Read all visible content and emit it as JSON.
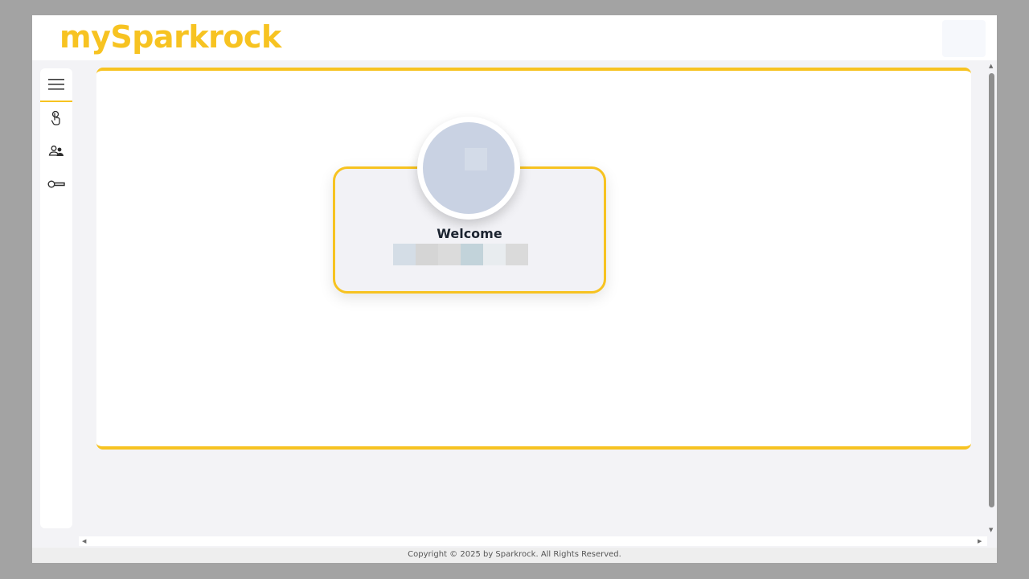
{
  "app": {
    "logo_text": "mySparkrock",
    "brand_color": "#f7c321"
  },
  "sidebar": {
    "items": [
      {
        "icon": "hamburger-menu-icon"
      },
      {
        "icon": "touch-pointer-icon"
      },
      {
        "icon": "user-group-icon"
      },
      {
        "icon": "key-icon"
      }
    ]
  },
  "welcome": {
    "title": "Welcome"
  },
  "footer": {
    "copyright": "Copyright © 2025 by Sparkrock. All Rights Reserved."
  }
}
